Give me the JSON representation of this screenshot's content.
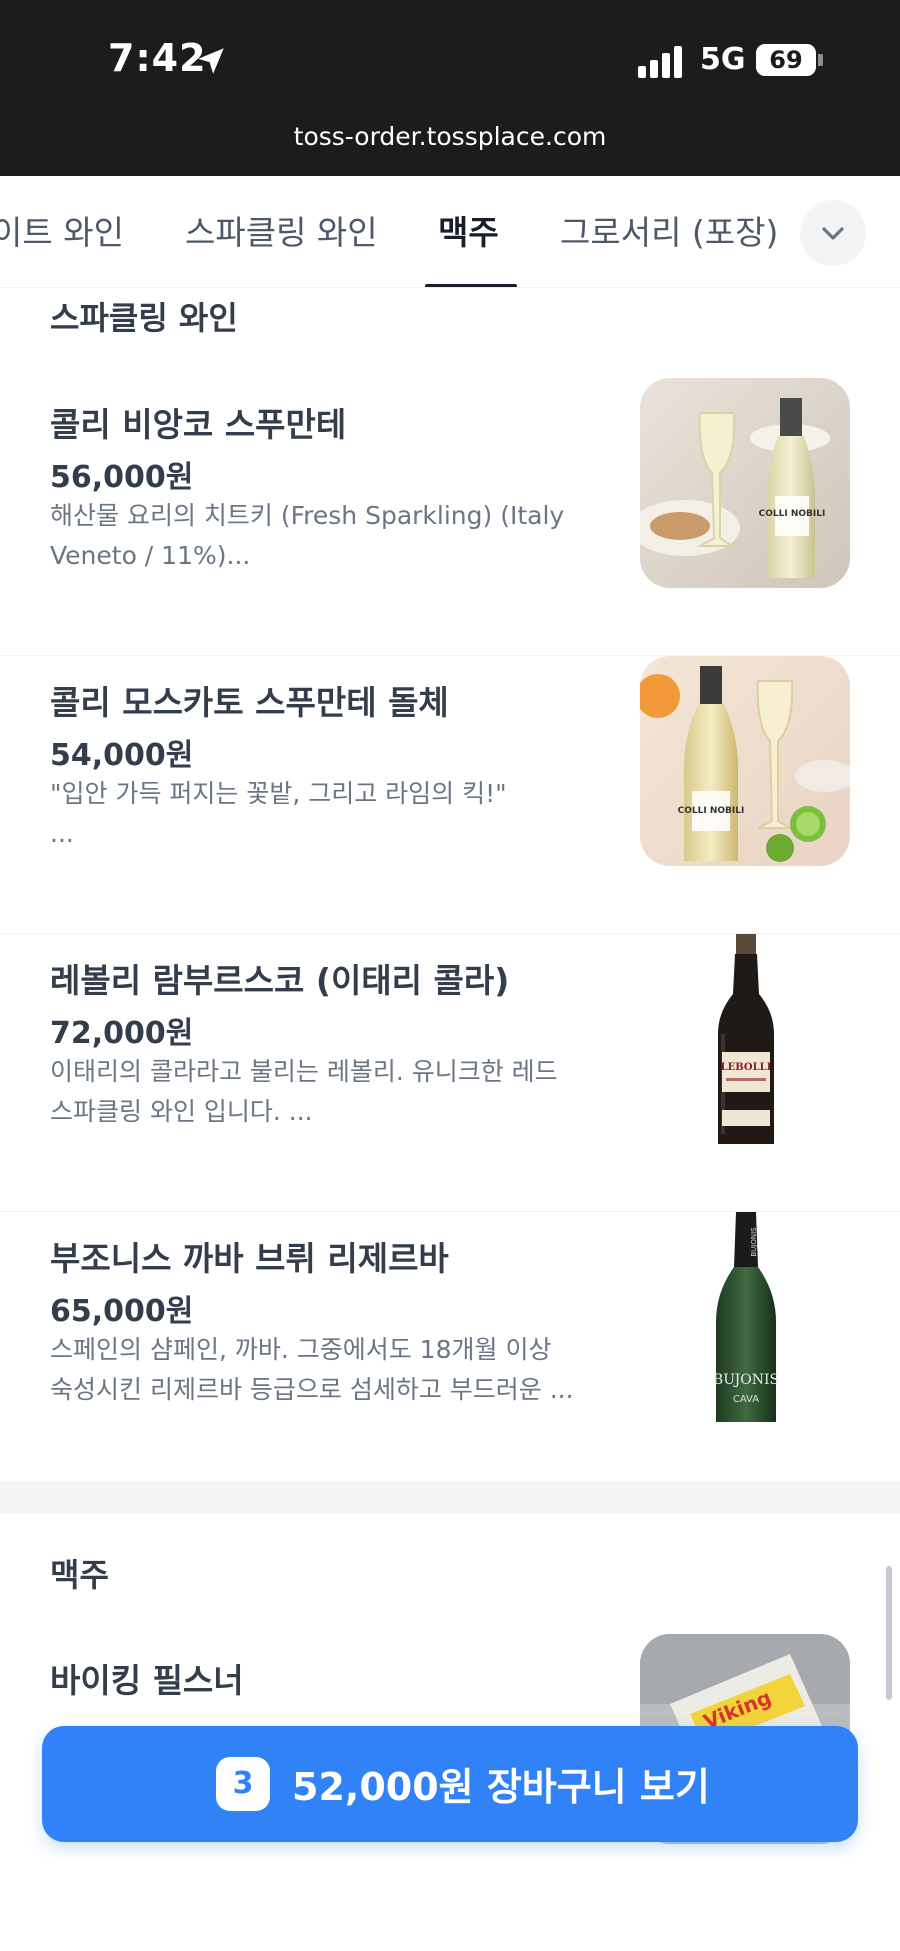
{
  "status_bar": {
    "time": "7:42",
    "network": "5G",
    "battery": "69"
  },
  "browser": {
    "url": "toss-order.tossplace.com"
  },
  "tabs": [
    {
      "label": "화이트 와인",
      "visible_label": "이트 와인",
      "active": false
    },
    {
      "label": "스파클링 와인",
      "active": false
    },
    {
      "label": "맥주",
      "active": true
    },
    {
      "label": "그로서리 (포장)",
      "active": false
    }
  ],
  "sections": {
    "sparkling": {
      "title": "스파클링 와인",
      "items": [
        {
          "name": "콜리 비앙코 스푸만테",
          "price": "56,000원",
          "desc_line1": "해산물 요리의 치트키 (Fresh Sparkling) (Italy",
          "desc_line2": "Veneto / 11%)...",
          "image": "white-sparkling-glass-photo",
          "bottle_label": "COLLI NOBILI"
        },
        {
          "name": "콜리 모스카토 스푸만테 돌체",
          "price": "54,000원",
          "desc_line1": "\"입안 가득 퍼지는 꽃밭, 그리고 라임의 킥!\"",
          "desc_line2": "...",
          "image": "moscato-glass-lime-photo",
          "bottle_label": "COLLI NOBILI"
        },
        {
          "name": "레볼리 람부르스코 (이태리 콜라)",
          "price": "72,000원",
          "desc_line1": "이태리의 콜라라고 불리는 레볼리. 유니크한 레드",
          "desc_line2": "스파클링 와인 입니다. ...",
          "image": "lebolli-bottle",
          "bottle_label": "LEBOLLI"
        },
        {
          "name": "부조니스 까바 브뤼 리제르바",
          "price": "65,000원",
          "desc_line1": "스페인의 샴페인, 까바. 그중에서도 18개월 이상",
          "desc_line2": "숙성시킨 리제르바 등급으로 섬세하고 부드러운 ...",
          "image": "bujonis-cava-bottle",
          "bottle_label": "BUJONIS",
          "bottle_sublabel": "CAVA"
        }
      ]
    },
    "beer": {
      "title": "맥주",
      "items": [
        {
          "name": "바이킹 필스너",
          "image": "viking-pilsner-can-photo",
          "can_label": "Viking"
        }
      ]
    }
  },
  "cart": {
    "count": "3",
    "label": "52,000원 장바구니 보기"
  },
  "colors": {
    "primary": "#3182f6",
    "text_primary": "#333d4b",
    "text_secondary": "#6b7684",
    "status_bar_bg": "#1c1c1e"
  }
}
